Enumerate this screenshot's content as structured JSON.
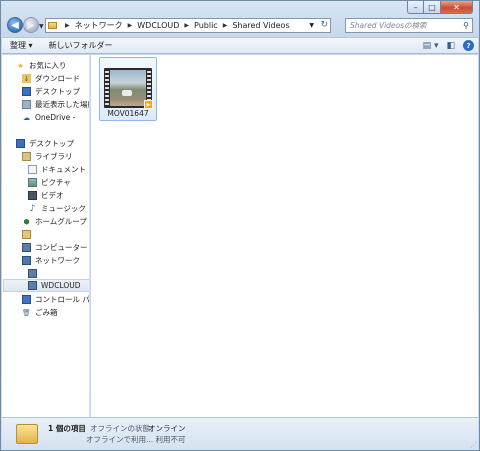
{
  "address": {
    "crumbs": [
      "ネットワーク",
      "WDCLOUD",
      "Public",
      "Shared Videos"
    ]
  },
  "search": {
    "placeholder": "Shared Videosの検索"
  },
  "toolbar": {
    "organize": "整理 ▾",
    "new_folder": "新しいフォルダー"
  },
  "nav": {
    "favorites": "お気に入り",
    "downloads": "ダウンロード",
    "desktop_fav": "デスクトップ",
    "recent": "最近表示した場所",
    "onedrive": "OneDrive -",
    "desktop": "デスクトップ",
    "libraries": "ライブラリ",
    "documents": "ドキュメント",
    "pictures": "ピクチャ",
    "videos": "ビデオ",
    "music": "ミュージック",
    "homegroup": "ホームグループ",
    "computer": "コンピューター",
    "network": "ネットワーク",
    "wdcloud": "WDCLOUD",
    "control_panel": "コントロール パネル",
    "recycle_bin": "ごみ箱"
  },
  "files": [
    {
      "name": "MOV01647"
    }
  ],
  "status": {
    "count": "1 個の項目",
    "offline_status_label": "オフラインの状態:",
    "offline_status_value": "オンライン",
    "offline_avail": "オフラインで利用... 利用不可"
  }
}
